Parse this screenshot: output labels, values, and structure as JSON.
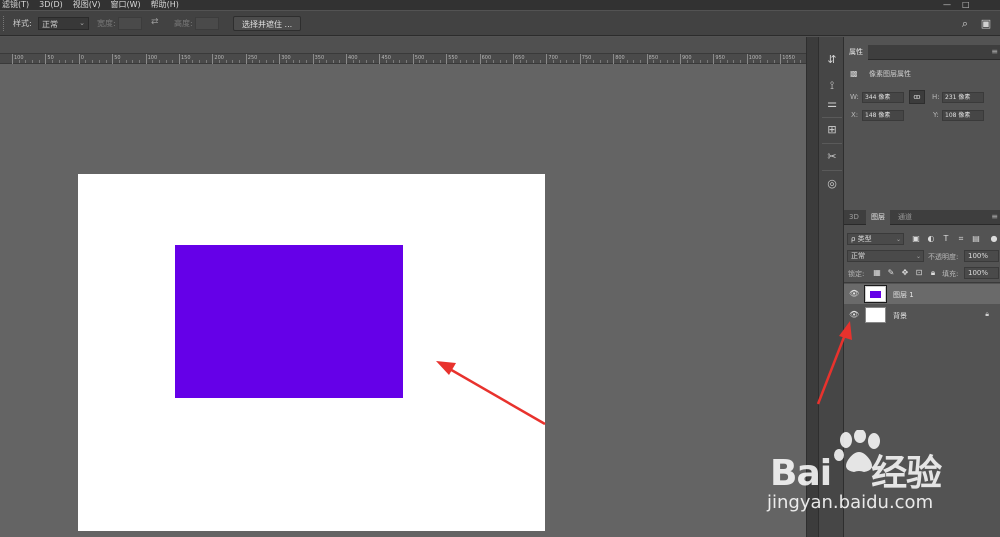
{
  "menubar": {
    "items": [
      "滤镜(T)",
      "3D(D)",
      "视图(V)",
      "窗口(W)",
      "帮助(H)"
    ],
    "minimize": "—",
    "restore": "□"
  },
  "options": {
    "style_label": "样式:",
    "style_value": "正常",
    "width_label": "宽度:",
    "height_label": "高度:",
    "swap_glyph": "⇄",
    "select_mask_button": "选择并遮住 ..."
  },
  "ruler": {
    "labels": [
      "100",
      "50",
      "0",
      "50",
      "100",
      "150",
      "200",
      "250",
      "300",
      "350",
      "400",
      "450",
      "500",
      "550",
      "600",
      "650",
      "700",
      "750",
      "800",
      "850",
      "900",
      "950",
      "1000",
      "1050"
    ]
  },
  "properties": {
    "tab_label": "属性",
    "title": "像素图层属性",
    "w_label": "W:",
    "w_value": "344 像素",
    "h_label": "H:",
    "h_value": "231 像素",
    "x_label": "X:",
    "x_value": "148 像素",
    "y_label": "Y:",
    "y_value": "108 像素",
    "link_glyph": "ꝏ"
  },
  "layers_panel": {
    "tabs": [
      "3D",
      "图层",
      "通道"
    ],
    "filter_kind": "ρ 类型",
    "blend_mode": "正常",
    "opacity_label": "不透明度:",
    "opacity_value": "100%",
    "lock_label": "锁定:",
    "fill_label": "填充:",
    "fill_value": "100%",
    "layers": [
      {
        "name": "图层 1",
        "selected": true
      },
      {
        "name": "背景",
        "selected": false
      }
    ]
  },
  "watermark": {
    "url": "jingyan.baidu.com"
  },
  "colors": {
    "rect_fill": "#6500e8",
    "arrow": "#e8322d"
  }
}
